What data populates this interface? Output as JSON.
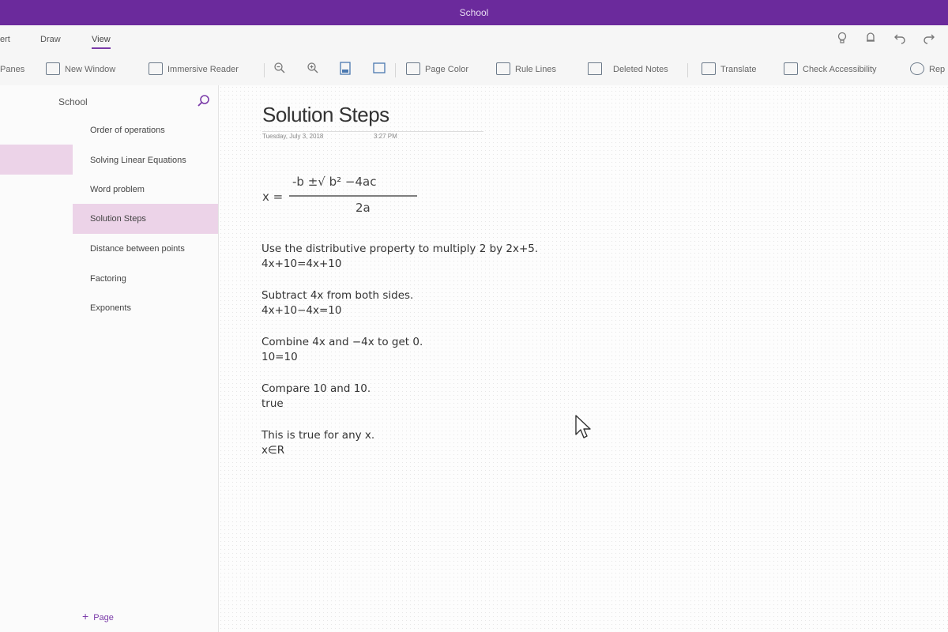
{
  "window": {
    "title": "School"
  },
  "ribbon_tabs": [
    {
      "label": "ert"
    },
    {
      "label": "Draw"
    },
    {
      "label": "View",
      "active": true
    }
  ],
  "ribbon_commands": {
    "panes": "Panes",
    "new_window": "New Window",
    "immersive_reader": "Immersive Reader",
    "page_color": "Page Color",
    "rule_lines": "Rule Lines",
    "deleted_notes": "Deleted Notes",
    "translate": "Translate",
    "check_accessibility": "Check Accessibility",
    "replay": "Rep"
  },
  "navigation": {
    "notebook": "School",
    "pages": [
      {
        "label": "Order of operations"
      },
      {
        "label": "Solving Linear Equations"
      },
      {
        "label": "Word problem"
      },
      {
        "label": "Solution Steps",
        "active": true
      },
      {
        "label": "Distance between points"
      },
      {
        "label": "Factoring"
      },
      {
        "label": "Exponents"
      }
    ],
    "add_page": "Page"
  },
  "note": {
    "title": "Solution Steps",
    "date": "Tuesday, July 3, 2018",
    "time": "3:27 PM",
    "formula": {
      "lhs": "x =",
      "numerator": "-b ±√ b² −4ac",
      "denominator": "2a"
    },
    "steps": [
      {
        "text": "Use the distributive property to multiply 2 by 2x+5.",
        "result": "4x+10=4x+10"
      },
      {
        "text": "Subtract 4x from both sides.",
        "result": "4x+10−4x=10"
      },
      {
        "text": "Combine 4x and −4x to get 0.",
        "result": "10=10"
      },
      {
        "text": "Compare 10 and 10.",
        "result": "true"
      },
      {
        "text": "This is true for any x.",
        "result": "x∈R"
      }
    ]
  },
  "colors": {
    "accent": "#6b2a9c",
    "selection": "#ecd3e8"
  }
}
